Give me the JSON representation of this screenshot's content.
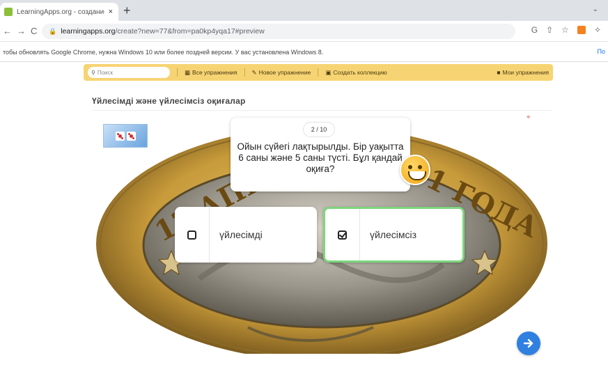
{
  "browser": {
    "tab_title": "LearningApps.org - создание м",
    "tab_close": "×",
    "new_tab": "+",
    "url_host": "learningapps.org",
    "url_path": "/create?new=77&from=pa0kp4yqa17#preview",
    "back": "←",
    "forward": "→",
    "reload": "C"
  },
  "infobar": {
    "message": "тобы обновлять Google Chrome, нужна Windows 10 или более поздней версии. У вас установлена Windows 8.",
    "more_link": "По"
  },
  "la_menu": {
    "search_placeholder": "Поиск",
    "all_exercises": "Все упражнения",
    "new_exercise": "Новое упражнение",
    "create_collection": "Создать коллекцию",
    "my_exercises": "Мои упражнения"
  },
  "exercise": {
    "title": "Үйлесімді және үйлесімсіз оқиғалар",
    "counter": "2 / 10",
    "question": "Ойын сүйегі лақтырылды. Бір уақытта 6 саны және 5 саны түсті. Бұл қандай оқиға?",
    "answers": [
      {
        "label": "үйлесімді",
        "checked": false
      },
      {
        "label": "үйлесімсіз",
        "checked": true
      }
    ],
    "coin_text_left": "12 АПРЕ",
    "coin_text_right": "61 ГОДА",
    "correct_color": "#7ed67e",
    "accent_color": "#2f80e0"
  },
  "icons": {
    "favicon": "learningapps-icon",
    "lock": "lock-icon",
    "share": "share-icon",
    "star": "star-icon",
    "extension": "extension-icon",
    "puzzle": "puzzle-icon",
    "fullscreen": "fullscreen-icon",
    "next": "arrow-right-icon"
  }
}
